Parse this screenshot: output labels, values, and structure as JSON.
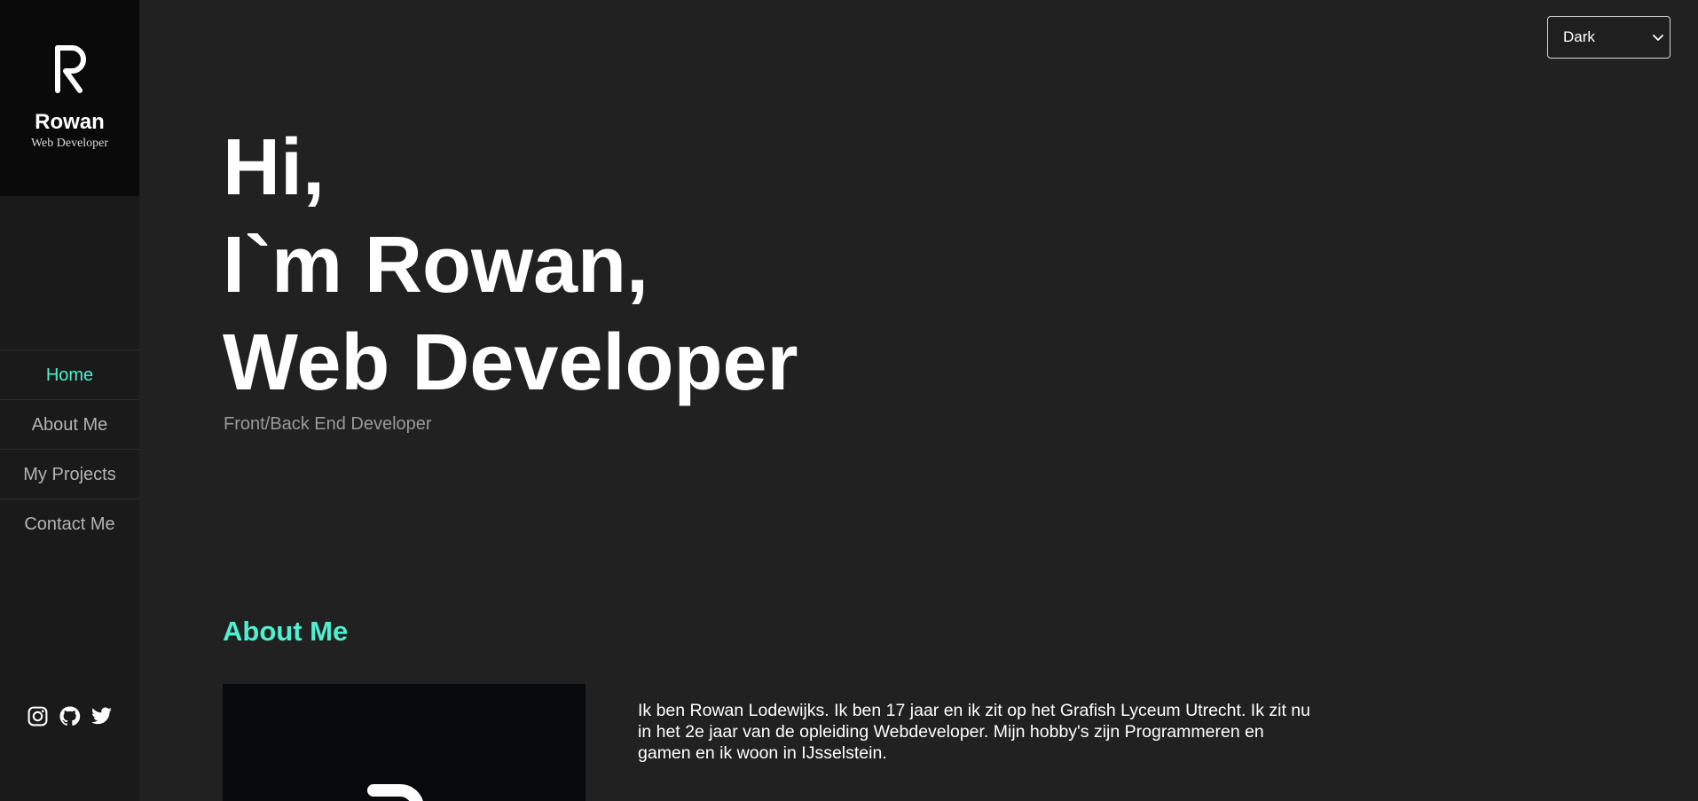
{
  "sidebar": {
    "brand": {
      "name": "Rowan",
      "role": "Web Developer",
      "logo_icon": "r-logo-icon"
    },
    "nav": [
      {
        "label": "Home",
        "active": true
      },
      {
        "label": "About Me",
        "active": false
      },
      {
        "label": "My Projects",
        "active": false
      },
      {
        "label": "Contact Me",
        "active": false
      }
    ],
    "social": [
      "instagram-icon",
      "github-icon",
      "twitter-icon"
    ]
  },
  "theme_select": {
    "value": "Dark"
  },
  "hero": {
    "line1": "Hi,",
    "line2": "I`m Rowan,",
    "line3": "Web Developer",
    "subtitle": "Front/Back End Developer"
  },
  "about": {
    "title": "About Me",
    "text": "Ik ben Rowan Lodewijks. Ik ben 17 jaar en ik zit op het Grafish Lyceum Utrecht. Ik zit nu in het 2e jaar van de opleiding Webdeveloper. Mijn hobby's zijn Programmeren en gamen en ik woon in IJsselstein."
  },
  "colors": {
    "accent": "#4ef0d0",
    "background": "#212121",
    "sidebar": "#1a1a1a",
    "brand_block": "#0a0a0a"
  }
}
